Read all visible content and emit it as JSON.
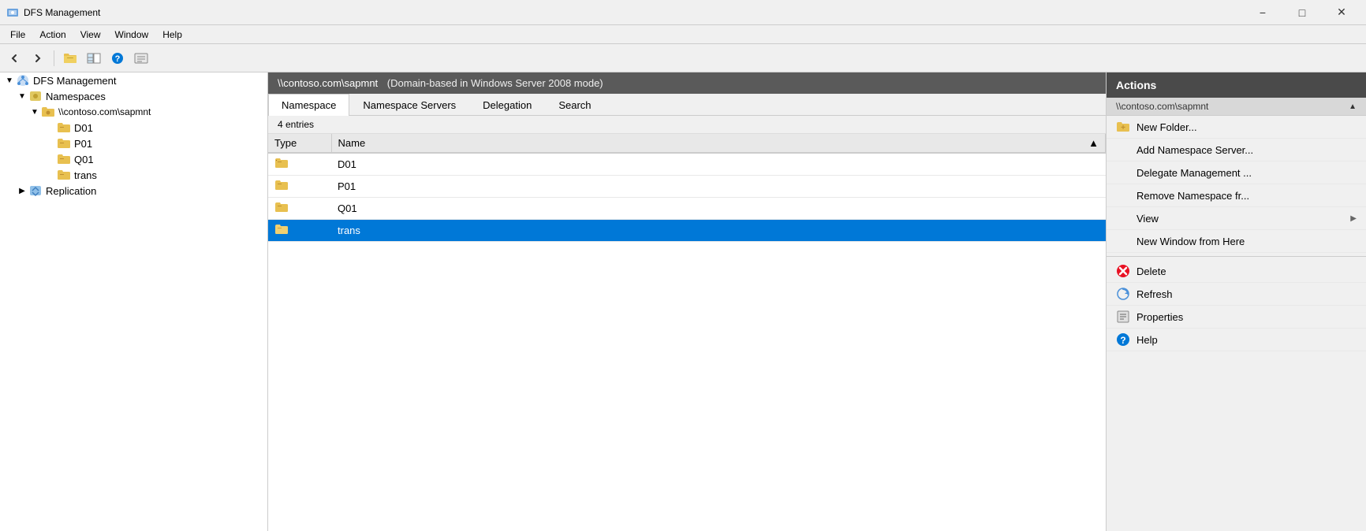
{
  "window": {
    "title": "DFS Management",
    "minimize_label": "−",
    "maximize_label": "□",
    "close_label": "✕"
  },
  "menubar": {
    "items": [
      {
        "label": "File"
      },
      {
        "label": "Action"
      },
      {
        "label": "View"
      },
      {
        "label": "Window"
      },
      {
        "label": "Help"
      }
    ]
  },
  "toolbar": {
    "buttons": [
      {
        "name": "back",
        "icon": "←"
      },
      {
        "name": "forward",
        "icon": "→"
      },
      {
        "name": "up",
        "icon": "📁"
      },
      {
        "name": "show-hide",
        "icon": "◫"
      },
      {
        "name": "help",
        "icon": "?"
      },
      {
        "name": "properties",
        "icon": "☰"
      }
    ]
  },
  "tree": {
    "items": [
      {
        "id": "dfs-management",
        "label": "DFS Management",
        "indent": 0,
        "expanded": true,
        "icon": "dfs"
      },
      {
        "id": "namespaces",
        "label": "Namespaces",
        "indent": 1,
        "expanded": true,
        "icon": "namespaces"
      },
      {
        "id": "contoso-sapmnt",
        "label": "\\\\contoso.com\\sapmnt",
        "indent": 2,
        "expanded": true,
        "icon": "namespace",
        "selected": false
      },
      {
        "id": "D01",
        "label": "D01",
        "indent": 3,
        "icon": "folder"
      },
      {
        "id": "P01",
        "label": "P01",
        "indent": 3,
        "icon": "folder"
      },
      {
        "id": "Q01",
        "label": "Q01",
        "indent": 3,
        "icon": "folder"
      },
      {
        "id": "trans",
        "label": "trans",
        "indent": 3,
        "icon": "folder"
      },
      {
        "id": "replication",
        "label": "Replication",
        "indent": 1,
        "expanded": false,
        "icon": "replication"
      }
    ]
  },
  "content": {
    "header_path": "\\\\contoso.com\\sapmnt",
    "header_mode": "(Domain-based in Windows Server 2008 mode)",
    "tabs": [
      {
        "id": "namespace",
        "label": "Namespace",
        "active": true
      },
      {
        "id": "namespace-servers",
        "label": "Namespace Servers",
        "active": false
      },
      {
        "id": "delegation",
        "label": "Delegation",
        "active": false
      },
      {
        "id": "search",
        "label": "Search",
        "active": false
      }
    ],
    "entries_count": "4 entries",
    "columns": [
      {
        "id": "type",
        "label": "Type"
      },
      {
        "id": "name",
        "label": "Name",
        "sort": "▲"
      }
    ],
    "rows": [
      {
        "id": "D01",
        "type": "folder",
        "name": "D01",
        "selected": false
      },
      {
        "id": "P01",
        "type": "folder",
        "name": "P01",
        "selected": false
      },
      {
        "id": "Q01",
        "type": "folder",
        "name": "Q01",
        "selected": false
      },
      {
        "id": "trans",
        "type": "folder",
        "name": "trans",
        "selected": true
      }
    ]
  },
  "actions": {
    "panel_title": "Actions",
    "section_title": "\\\\contoso.com\\sapmnt",
    "items": [
      {
        "id": "new-folder",
        "label": "New Folder...",
        "icon": "new-folder",
        "has_icon": true
      },
      {
        "id": "add-ns-server",
        "label": "Add Namespace Server...",
        "icon": "none",
        "has_icon": false
      },
      {
        "id": "delegate-mgmt",
        "label": "Delegate Management ...",
        "icon": "none",
        "has_icon": false
      },
      {
        "id": "remove-ns",
        "label": "Remove Namespace fr...",
        "icon": "none",
        "has_icon": false
      },
      {
        "id": "view",
        "label": "View",
        "icon": "none",
        "has_icon": false,
        "has_arrow": true
      },
      {
        "id": "new-window",
        "label": "New Window from Here",
        "icon": "none",
        "has_icon": false
      },
      {
        "id": "delete",
        "label": "Delete",
        "icon": "delete",
        "has_icon": true
      },
      {
        "id": "refresh",
        "label": "Refresh",
        "icon": "refresh",
        "has_icon": true
      },
      {
        "id": "properties",
        "label": "Properties",
        "icon": "properties",
        "has_icon": true
      },
      {
        "id": "help",
        "label": "Help",
        "icon": "help",
        "has_icon": true
      }
    ]
  }
}
